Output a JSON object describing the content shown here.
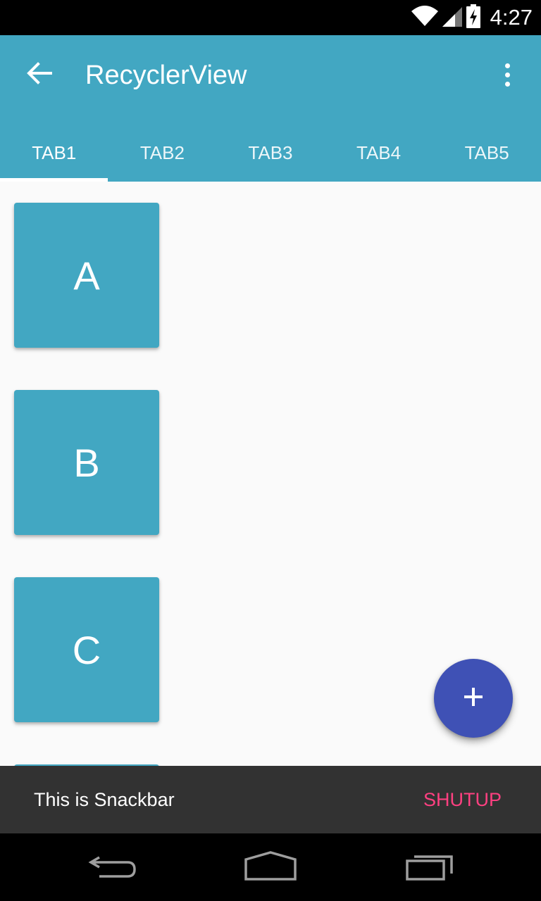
{
  "status_bar": {
    "time": "4:27",
    "icons": [
      "wifi-icon",
      "signal-icon",
      "battery-charging-icon"
    ]
  },
  "app_bar": {
    "title": "RecyclerView",
    "back_icon": "arrow-back-icon",
    "menu_icon": "more-vert-icon"
  },
  "tabs": [
    {
      "label": "TAB1",
      "selected": true
    },
    {
      "label": "TAB2",
      "selected": false
    },
    {
      "label": "TAB3",
      "selected": false
    },
    {
      "label": "TAB4",
      "selected": false
    },
    {
      "label": "TAB5",
      "selected": false
    }
  ],
  "cards": [
    {
      "label": "A"
    },
    {
      "label": "B"
    },
    {
      "label": "C"
    }
  ],
  "fab": {
    "icon": "add-icon"
  },
  "snackbar": {
    "message": "This is Snackbar",
    "action": "SHUTUP"
  },
  "nav_bar": {
    "icons": [
      "back-nav-icon",
      "home-nav-icon",
      "recents-nav-icon"
    ]
  },
  "colors": {
    "primary": "#42a7c2",
    "accent": "#ff4081",
    "fab": "#3f51b5",
    "background": "#fafafa",
    "snackbar": "#323232"
  }
}
